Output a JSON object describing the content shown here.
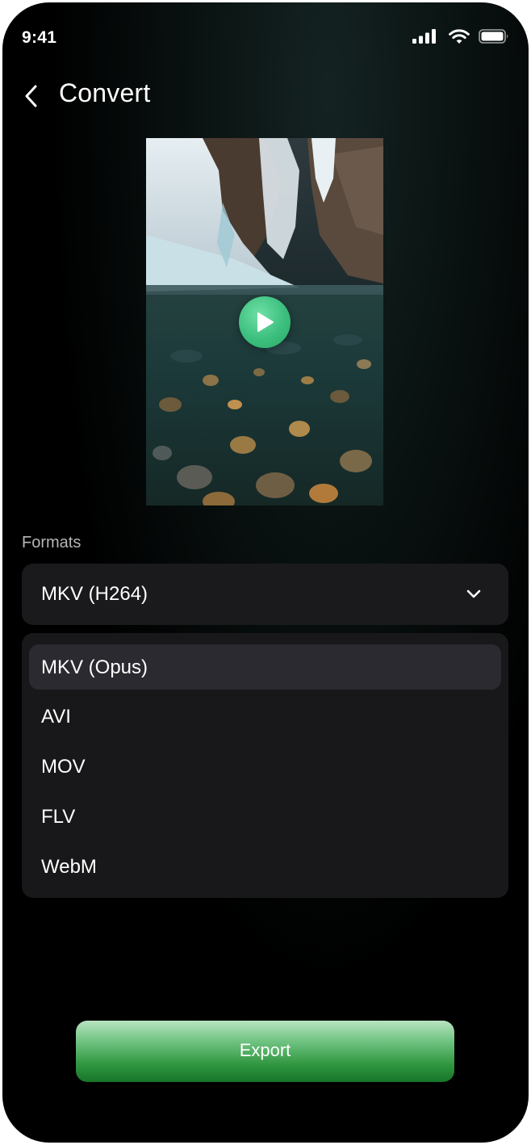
{
  "status_bar": {
    "time": "9:41",
    "icons": [
      "signal-icon",
      "wifi-icon",
      "battery-icon"
    ]
  },
  "header": {
    "title": "Convert",
    "back_icon": "chevron-left-icon"
  },
  "video": {
    "play_icon": "play-icon",
    "accent": "#3cbf7e"
  },
  "formats": {
    "label": "Formats",
    "selected": "MKV (H264)",
    "options": [
      {
        "label": "MKV (Opus)",
        "highlighted": true
      },
      {
        "label": "AVI",
        "highlighted": false
      },
      {
        "label": "MOV",
        "highlighted": false
      },
      {
        "label": "FLV",
        "highlighted": false
      },
      {
        "label": "WebM",
        "highlighted": false
      }
    ]
  },
  "export": {
    "label": "Export",
    "color": "#2f963f"
  }
}
